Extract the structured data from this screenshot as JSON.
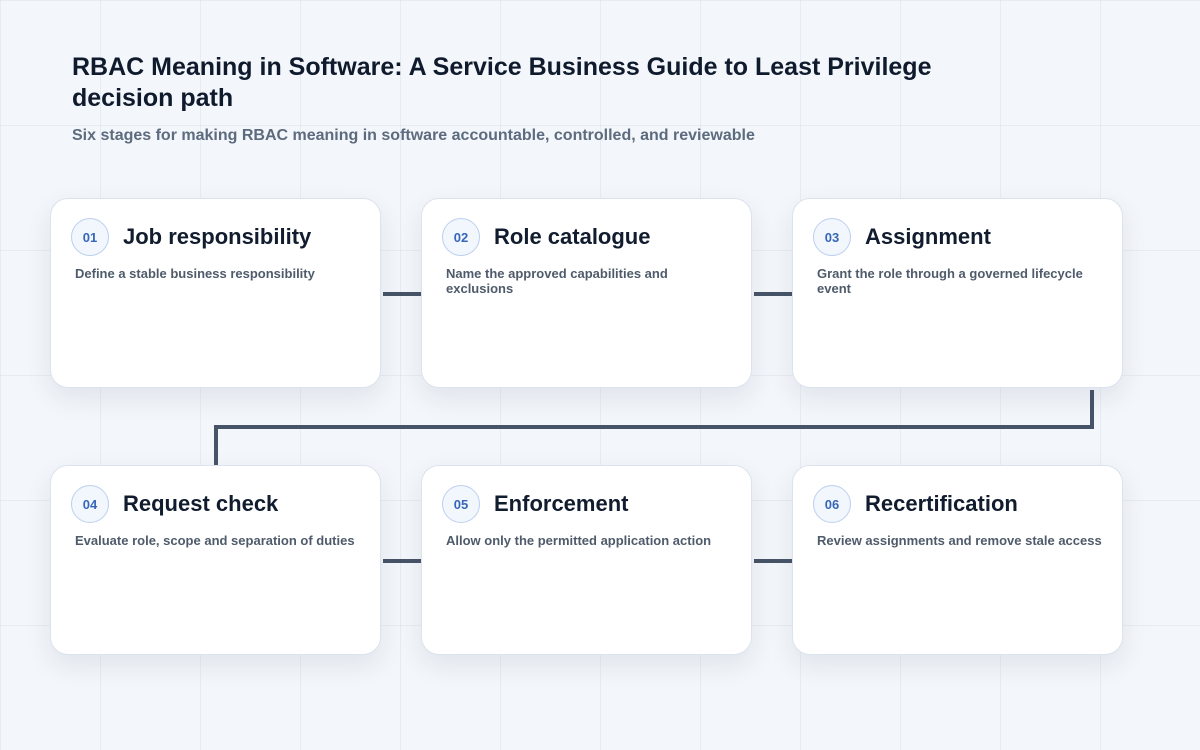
{
  "header": {
    "title": "RBAC Meaning in Software: A Service Business Guide to Least Privilege decision path",
    "subtitle": "Six stages for making RBAC meaning in software accountable, controlled, and reviewable"
  },
  "colors": {
    "connector": "#475467",
    "badge_text": "#3566b8",
    "badge_border": "#bcd0ee",
    "card_border": "#dbe3ee"
  },
  "stages": [
    {
      "number": "01",
      "title": "Job responsibility",
      "description": "Define a stable business responsibility"
    },
    {
      "number": "02",
      "title": "Role catalogue",
      "description": "Name the approved capabilities and exclusions"
    },
    {
      "number": "03",
      "title": "Assignment",
      "description": "Grant the role through a governed lifecycle event"
    },
    {
      "number": "04",
      "title": "Request check",
      "description": "Evaluate role, scope and separation of duties"
    },
    {
      "number": "05",
      "title": "Enforcement",
      "description": "Allow only the permitted application action"
    },
    {
      "number": "06",
      "title": "Recertification",
      "description": "Review assignments and remove stale access"
    }
  ]
}
